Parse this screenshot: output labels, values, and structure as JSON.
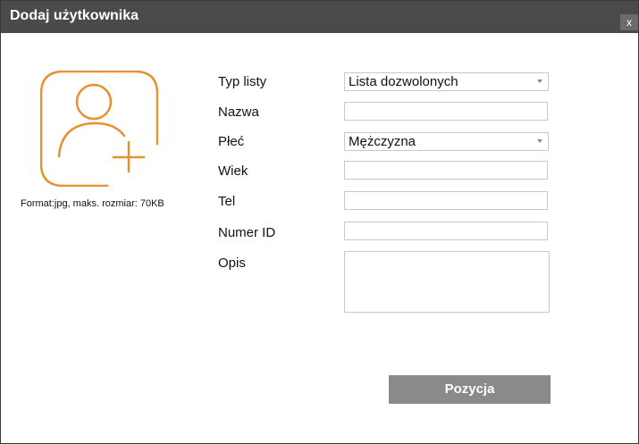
{
  "dialog": {
    "title": "Dodaj użytkownika",
    "close_glyph": "x"
  },
  "photo": {
    "icon": "add-user-icon",
    "accent_color": "#e8902f",
    "format_note": "Format:jpg, maks. rozmiar: 70KB"
  },
  "form": {
    "list_type": {
      "label": "Typ listy",
      "value": "Lista dozwolonych"
    },
    "name": {
      "label": "Nazwa",
      "value": ""
    },
    "gender": {
      "label": "Płeć",
      "value": "Mężczyzna"
    },
    "age": {
      "label": "Wiek",
      "value": ""
    },
    "phone": {
      "label": "Tel",
      "value": ""
    },
    "id_number": {
      "label": "Numer ID",
      "value": ""
    },
    "description": {
      "label": "Opis",
      "value": ""
    }
  },
  "submit": {
    "label": "Pozycja"
  }
}
